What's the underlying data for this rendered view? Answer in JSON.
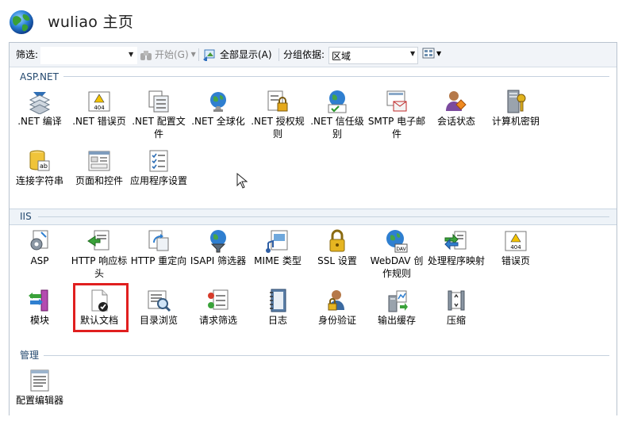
{
  "header": {
    "title": "wuliao 主页"
  },
  "toolbar": {
    "filter_label": "筛选:",
    "filter_value": "",
    "start_label": "开始(G)",
    "show_all_label": "全部显示(A)",
    "group_label": "分组依据:",
    "group_value": "区域"
  },
  "sections": [
    {
      "title": "ASP.NET"
    },
    {
      "title": "IIS"
    },
    {
      "title": "管理"
    }
  ],
  "items": [
    ".NET 编译",
    ".NET 错误页",
    ".NET 配置文件",
    ".NET 全球化",
    ".NET 授权规则",
    ".NET 信任级别",
    "SMTP 电子邮件",
    "会话状态",
    "计算机密钥",
    "连接字符串",
    "页面和控件",
    "应用程序设置",
    "ASP",
    "HTTP 响应标头",
    "HTTP 重定向",
    "ISAPI 筛选器",
    "MIME 类型",
    "SSL 设置",
    "WebDAV 创作规则",
    "处理程序映射",
    "错误页",
    "模块",
    "默认文档",
    "目录浏览",
    "请求筛选",
    "日志",
    "身份验证",
    "输出缓存",
    "压缩",
    "配置编辑器"
  ],
  "selected_item": "默认文档",
  "colors": {
    "accent": "#24496f",
    "highlight": "#e01f1f"
  }
}
